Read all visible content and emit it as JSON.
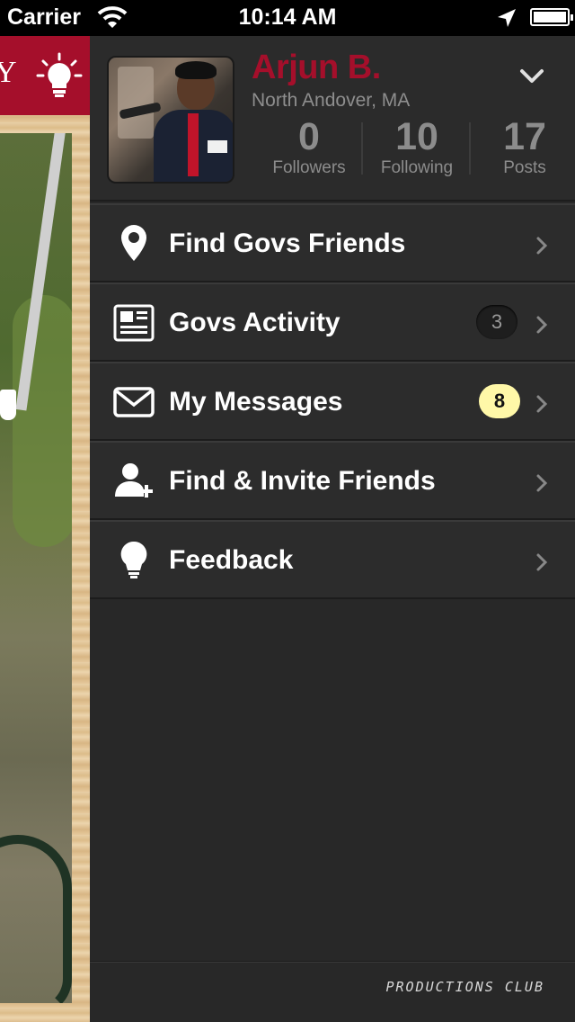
{
  "status_bar": {
    "carrier": "Carrier",
    "time": "10:14 AM"
  },
  "main_screen": {
    "nav_letter": "Y"
  },
  "profile": {
    "name": "Arjun B.",
    "location": "North Andover, MA",
    "stats": [
      {
        "value": "0",
        "label": "Followers"
      },
      {
        "value": "10",
        "label": "Following"
      },
      {
        "value": "17",
        "label": "Posts"
      }
    ]
  },
  "menu": {
    "items": [
      {
        "label": "Find Govs Friends",
        "icon": "location-pin-icon"
      },
      {
        "label": "Govs Activity",
        "icon": "newspaper-icon",
        "badge": "3"
      },
      {
        "label": "My Messages",
        "icon": "envelope-icon",
        "badge": "8"
      },
      {
        "label": "Find & Invite Friends",
        "icon": "add-person-icon"
      },
      {
        "label": "Feedback",
        "icon": "lightbulb-icon"
      }
    ]
  },
  "footer": {
    "brand": "PRODUCTIONS CLUB"
  },
  "colors": {
    "brand_red": "#a50f2b",
    "drawer_bg": "#282828",
    "badge_yellow": "#fff8a8"
  }
}
